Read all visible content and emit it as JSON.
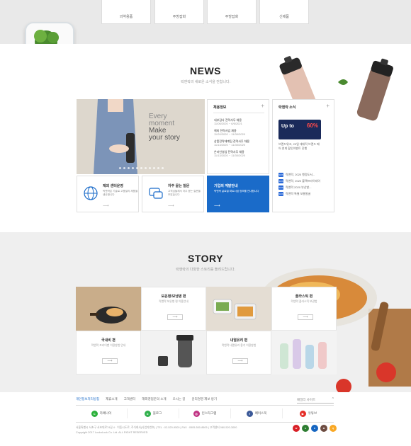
{
  "categories": [
    {
      "label": "의약용품"
    },
    {
      "label": "주방잡화"
    },
    {
      "label": "주방잡화"
    },
    {
      "label": "신제품"
    }
  ],
  "news": {
    "title": "NEWS",
    "subtitle": "락앤락의 새로운 소식을 전합니다.",
    "banner": {
      "line1": "Every",
      "line2": "moment",
      "line3": "Make",
      "line4": "your story"
    },
    "recruit": {
      "heading": "채용정보",
      "items": [
        {
          "title": "내부감사 전략사무 채용",
          "date": "11/06/2020 ~ 6/6/2021"
        },
        {
          "title": "해외 전략사업 채용",
          "date": "11/20/2020 ~ 11/30/2020"
        },
        {
          "title": "상품전략체계팀 전략사무 채용",
          "date": "11/13/2020 ~ 11/30/2020"
        },
        {
          "title": "온라인영업 전략사무 채용",
          "date": "11/13/2020 ~ 11/30/2020"
        }
      ]
    },
    "sns": {
      "heading": "락앤락 소식",
      "image_label": "Up to",
      "image_percent": "60%",
      "blurb": "브랜드위크, 29일 대대적 브랜드 페어 연계 할인이벤트 진행",
      "list": [
        {
          "tag": "SNS",
          "text": "락앤락, 2020 행정도서..."
        },
        {
          "tag": "SNS",
          "text": "락앤락, 2020 블랙프라이데이"
        },
        {
          "tag": "SNS",
          "text": "락앤락 2020 부산발..."
        },
        {
          "tag": "SNS",
          "text": "락앤락 특별 보물발굴"
        }
      ]
    },
    "cards": [
      {
        "title": "제외 센터운영",
        "text": "락앤락은 기술로 고품질의 제품을 생산합니다"
      },
      {
        "title": "자주 묻는 질문",
        "text": "고객님들께서 자주 묻는 질문을 모았습니다"
      },
      {
        "title": "기업의 계발안내",
        "text": "락앤락 글로벌 파트너쉽 정보를 안내합니다"
      }
    ]
  },
  "story": {
    "title": "STORY",
    "subtitle": "락앤락의 다양한 스토리를 들려드립니다.",
    "cells": [
      {
        "title": "보온병/보냉병 편",
        "sub": "락앤락 보온병 편 이용안내"
      },
      {
        "title": "플라스틱 편",
        "sub": "락앤락 플라스틱 보관법"
      },
      {
        "title": "국내비 편",
        "sub": "락앤락 프라이팬 이용방법 안내"
      },
      {
        "title": "내열유리 편",
        "sub": "락앤락 내열유리 용기 이용방법"
      }
    ]
  },
  "footer": {
    "nav": [
      "개인정보처리방침",
      "제휴소개",
      "고객센터",
      "해외영업문의 소개",
      "오시는 길",
      "윤리경영 제보 방기"
    ],
    "family": "패밀리 사이트",
    "sns": [
      {
        "name": "카페나이",
        "color": "#2bb03a",
        "short": "C"
      },
      {
        "name": "블로그",
        "color": "#30b04c",
        "short": "b"
      },
      {
        "name": "인스타그램",
        "color": "#c13584",
        "short": "◎"
      },
      {
        "name": "페이스북",
        "color": "#3b5998",
        "short": "f"
      },
      {
        "name": "유튜브",
        "color": "#e52d27",
        "short": "▶"
      }
    ],
    "info1": "서울특별시 서초구 서초대로74길 4 · 이동시도로, 주식회사(사업자번호)   |   TEL : 02-520-9500   |   FAX : 0505-500-8505   |   고객센터 080-520-3000",
    "info2": "Copyright 2017 LocknLock Co. Ltd. ALL RIGHT RESERVED",
    "badges": [
      {
        "label": "W",
        "color": "#d81f26"
      },
      {
        "label": "A",
        "color": "#2e7d32"
      },
      {
        "label": "K",
        "color": "#1565c0"
      },
      {
        "label": "M",
        "color": "#6d4c41"
      },
      {
        "label": "Q",
        "color": "#f9a825"
      }
    ]
  }
}
